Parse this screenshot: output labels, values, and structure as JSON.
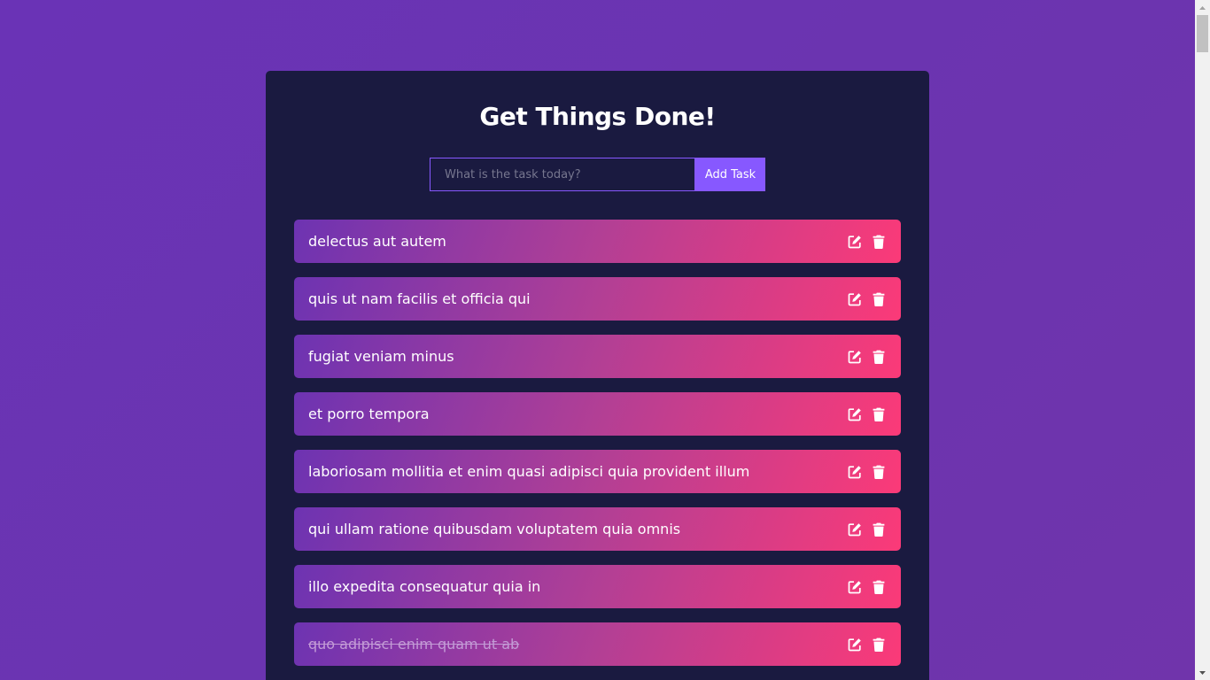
{
  "app": {
    "title": "Get Things Done!"
  },
  "form": {
    "input_value": "",
    "input_placeholder": "What is the task today?",
    "submit_label": "Add Task"
  },
  "todos": [
    {
      "text": "delectus aut autem",
      "completed": false
    },
    {
      "text": "quis ut nam facilis et officia qui",
      "completed": false
    },
    {
      "text": "fugiat veniam minus",
      "completed": false
    },
    {
      "text": "et porro tempora",
      "completed": false
    },
    {
      "text": "laboriosam mollitia et enim quasi adipisci quia provident illum",
      "completed": false
    },
    {
      "text": "qui ullam ratione quibusdam voluptatem quia omnis",
      "completed": false
    },
    {
      "text": "illo expedita consequatur quia in",
      "completed": false
    },
    {
      "text": "quo adipisci enim quam ut ab",
      "completed": true
    }
  ],
  "icons": {
    "edit": "edit-icon",
    "delete": "trash-icon"
  },
  "colors": {
    "page_background": "#6b34b0",
    "card_background": "#1a1a40",
    "accent": "#8758ff",
    "todo_gradient_start": "#6d33b2",
    "todo_gradient_end": "#fb3a78",
    "completed_text": "#c39bd6"
  }
}
